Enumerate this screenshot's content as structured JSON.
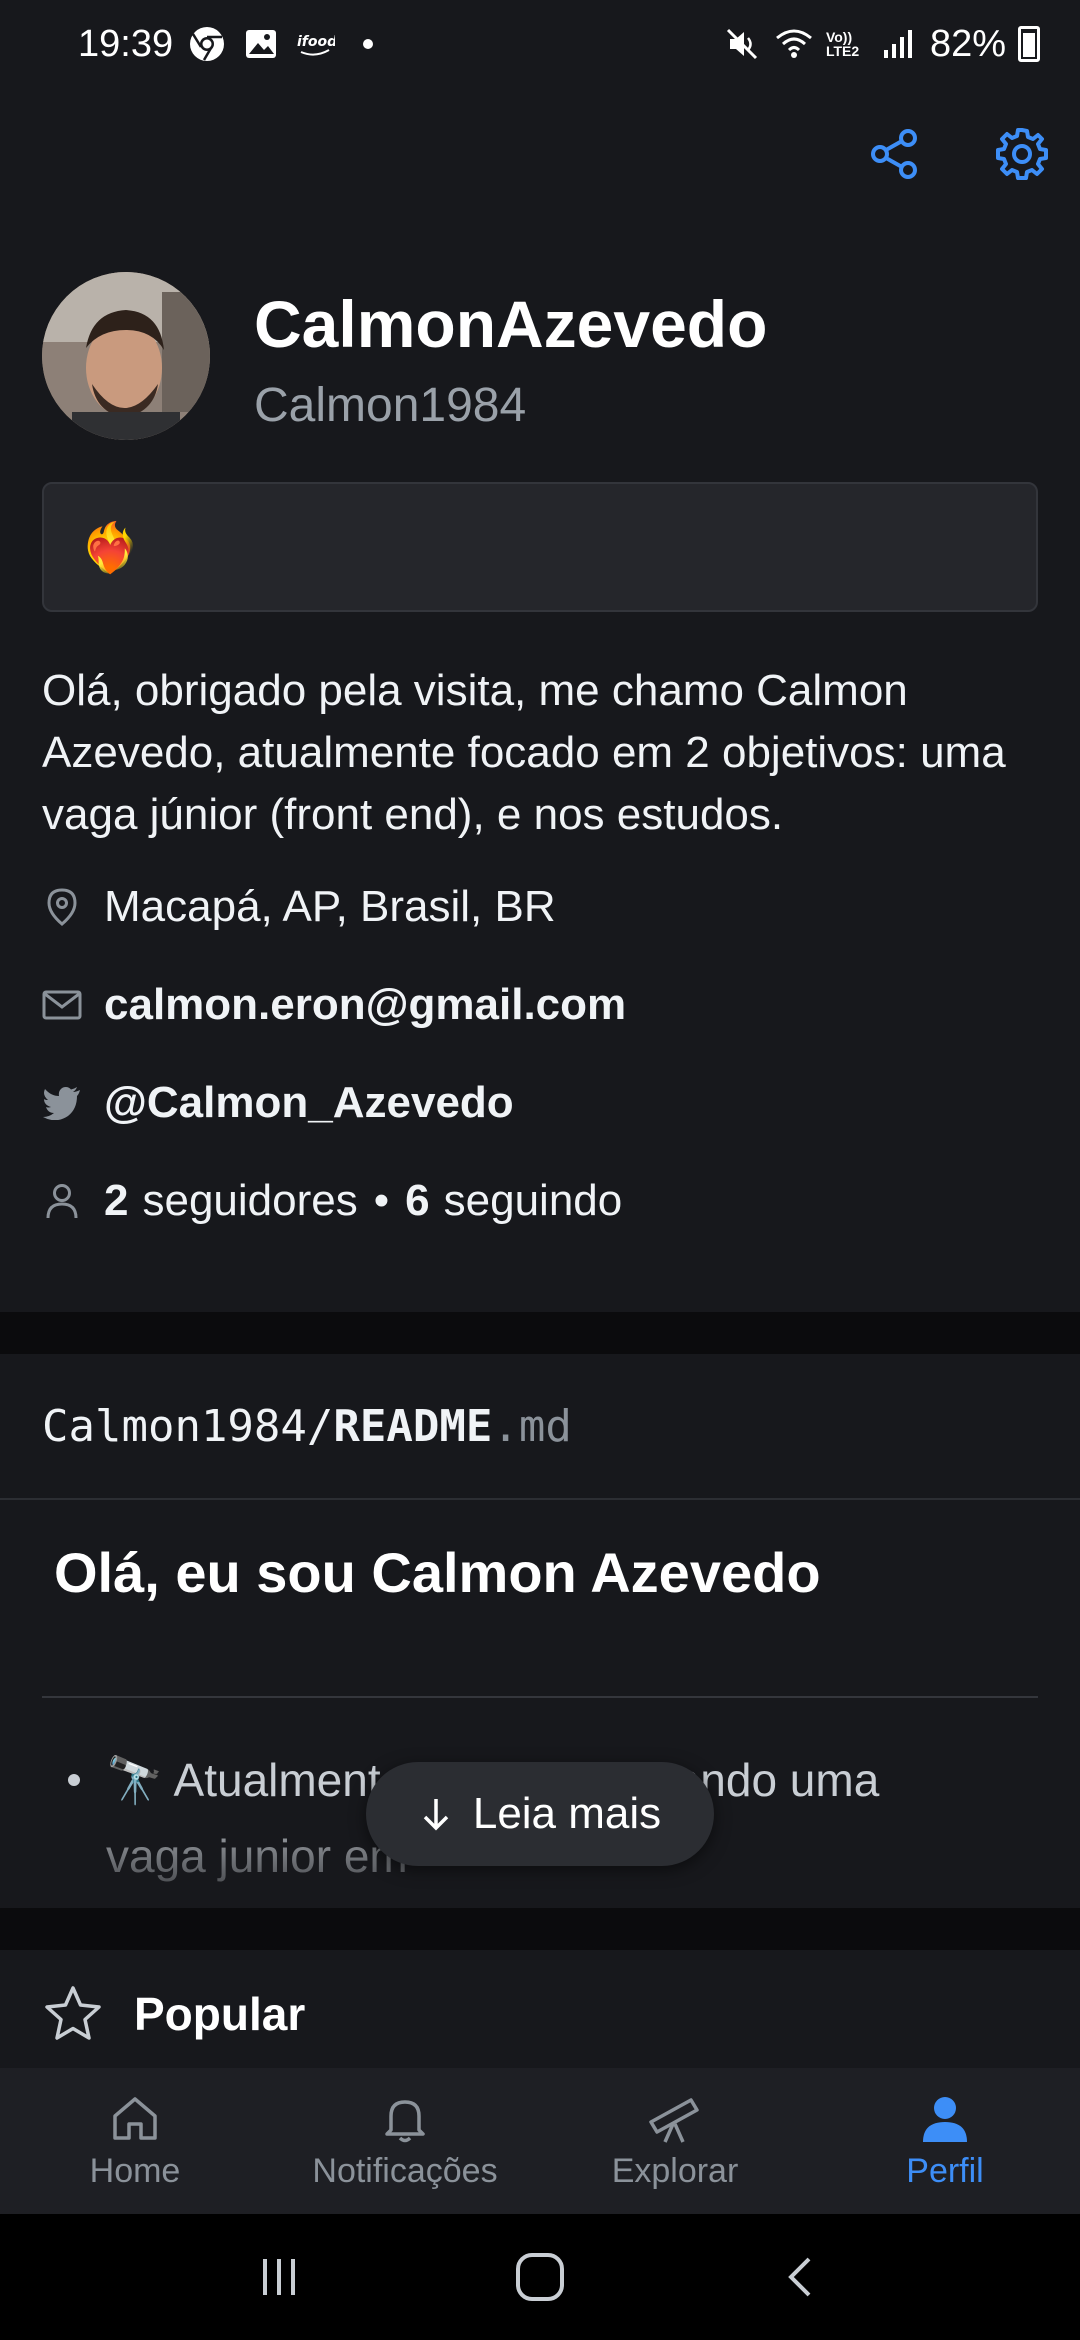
{
  "status_bar": {
    "time": "19:39",
    "battery": "82%",
    "notification_icons": [
      "chrome-icon",
      "gallery-icon",
      "ifood-icon"
    ],
    "system_icons": [
      "mute-icon",
      "wifi-icon",
      "volte-icon",
      "signal-icon",
      "battery-icon"
    ],
    "volte_label": "Vo)) LTE2"
  },
  "profile": {
    "name": "CalmonAzevedo",
    "login": "Calmon1984",
    "status_emoji": "❤️‍🔥",
    "bio": "Olá, obrigado pela visita, me chamo Calmon Azevedo, atualmente focado em 2 objetivos: uma vaga júnior (front end), e nos estudos.",
    "location": "Macapá, AP, Brasil, BR",
    "email": "calmon.eron@gmail.com",
    "twitter": "@Calmon_Azevedo",
    "followers_count": "2",
    "followers_label": "seguidores",
    "following_count": "6",
    "following_label": "seguindo",
    "separator": "•"
  },
  "readme": {
    "owner": "Calmon1984/",
    "file": "README",
    "ext": ".md",
    "title": "Olá, eu sou Calmon Azevedo",
    "first_item": "🔭 Atualmente estou procurando uma vaga junior em",
    "read_more": "Leia mais"
  },
  "popular": {
    "label": "Popular"
  },
  "bottom_nav": {
    "items": [
      {
        "label": "Home",
        "icon": "home-icon"
      },
      {
        "label": "Notificações",
        "icon": "bell-icon"
      },
      {
        "label": "Explorar",
        "icon": "telescope-icon"
      },
      {
        "label": "Perfil",
        "icon": "person-icon"
      }
    ],
    "active_index": 3
  },
  "colors": {
    "background": "#17181c",
    "accent": "#3d8ef7",
    "muted": "#8b929a",
    "surface": "#25262b"
  }
}
